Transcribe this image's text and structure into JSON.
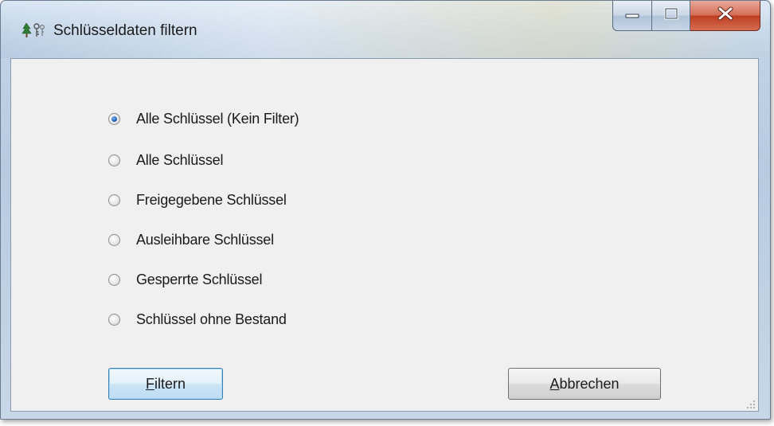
{
  "window": {
    "title": "Schlüsseldaten filtern",
    "app_icon": "keys-tree-icon",
    "caption_buttons": [
      {
        "name": "minimize",
        "icon": "minimize-icon"
      },
      {
        "name": "maximize",
        "icon": "maximize-icon"
      },
      {
        "name": "close",
        "icon": "close-icon"
      }
    ]
  },
  "filter_options": {
    "selected_index": 0,
    "items": [
      {
        "label": "Alle Schlüssel (Kein Filter)"
      },
      {
        "label": "Alle Schlüssel"
      },
      {
        "label": "Freigegebene Schlüssel"
      },
      {
        "label": "Ausleihbare Schlüssel"
      },
      {
        "label": "Gesperrte Schlüssel"
      },
      {
        "label": "Schlüssel ohne Bestand"
      }
    ]
  },
  "buttons": {
    "filter_label": "Filtern",
    "filter_accesskey": "F",
    "cancel_label": "Abbrechen",
    "cancel_accesskey": "A"
  },
  "colors": {
    "accent": "#1e5fb8",
    "close_button": "#c8452a",
    "client_background": "#f0f0f0"
  }
}
